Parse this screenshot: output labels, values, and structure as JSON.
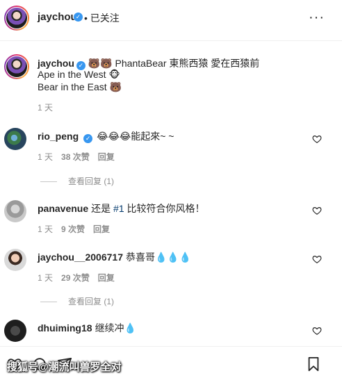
{
  "header": {
    "username": "jaychou",
    "separator": "•",
    "follow_status": "已关注",
    "more": "···"
  },
  "caption": {
    "username": "jaychou",
    "line1": "🐻🐻 PhantaBear 東熊西猿 愛在西猿前",
    "line2": "Ape in the West 🐵",
    "line3": "Bear in the East 🐻",
    "time": "1 天"
  },
  "comments": [
    {
      "username": "rio_peng",
      "verified": true,
      "text": "😂😂😂能起來~ ~",
      "time": "1 天",
      "likes": "38 次赞",
      "reply": "回复",
      "view_replies": "查看回复 (1)"
    },
    {
      "username": "panavenue",
      "text_before": "还是 ",
      "hashtag": "#1",
      "text_after": " 比较符合你风格！",
      "time": "1 天",
      "likes": "9 次赞",
      "reply": "回复"
    },
    {
      "username": "jaychou__2006717",
      "text": "恭喜哥💧💧💧",
      "time": "1 天",
      "likes": "29 次赞",
      "reply": "回复",
      "view_replies": "查看回复 (1)"
    },
    {
      "username": "dhuiming18",
      "text": "继续冲💧"
    }
  ],
  "watermark": "搜狐号@潮流叫兽罗全对",
  "colors": {
    "verified": "#3897f0",
    "secondary_text": "#8e8e8e",
    "hashtag": "#00376b"
  },
  "icons": [
    "heart-icon",
    "comment-icon",
    "share-icon",
    "bookmark-icon",
    "more-icon",
    "verified-icon"
  ]
}
